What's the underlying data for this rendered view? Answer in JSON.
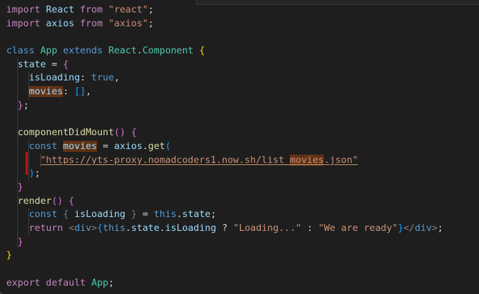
{
  "editor": {
    "lines": [
      [
        {
          "t": "import",
          "c": "ctl"
        },
        {
          "t": " ",
          "c": "pun"
        },
        {
          "t": "React",
          "c": "var"
        },
        {
          "t": " ",
          "c": "pun"
        },
        {
          "t": "from",
          "c": "ctl"
        },
        {
          "t": " ",
          "c": "pun"
        },
        {
          "t": "\"react\"",
          "c": "str"
        },
        {
          "t": ";",
          "c": "pun"
        }
      ],
      [
        {
          "t": "import",
          "c": "ctl"
        },
        {
          "t": " ",
          "c": "pun"
        },
        {
          "t": "axios",
          "c": "var"
        },
        {
          "t": " ",
          "c": "pun"
        },
        {
          "t": "from",
          "c": "ctl"
        },
        {
          "t": " ",
          "c": "pun"
        },
        {
          "t": "\"axios\"",
          "c": "str"
        },
        {
          "t": ";",
          "c": "pun"
        }
      ],
      [],
      [
        {
          "t": "class",
          "c": "kw"
        },
        {
          "t": " ",
          "c": "pun"
        },
        {
          "t": "App",
          "c": "cls"
        },
        {
          "t": " ",
          "c": "pun"
        },
        {
          "t": "extends",
          "c": "kw"
        },
        {
          "t": " ",
          "c": "pun"
        },
        {
          "t": "React",
          "c": "cls"
        },
        {
          "t": ".",
          "c": "pun"
        },
        {
          "t": "Component",
          "c": "cls"
        },
        {
          "t": " ",
          "c": "pun"
        },
        {
          "t": "{",
          "c": "br1"
        }
      ],
      [
        {
          "t": "  ",
          "c": "pun"
        },
        {
          "t": "state",
          "c": "var"
        },
        {
          "t": " = ",
          "c": "pun"
        },
        {
          "t": "{",
          "c": "br2"
        }
      ],
      [
        {
          "t": "    ",
          "c": "pun"
        },
        {
          "t": "isLoading",
          "c": "var"
        },
        {
          "t": ": ",
          "c": "pun"
        },
        {
          "t": "true",
          "c": "kw"
        },
        {
          "t": ",",
          "c": "pun"
        }
      ],
      [
        {
          "t": "    ",
          "c": "pun"
        },
        {
          "t": "movies",
          "c": "var hl"
        },
        {
          "t": ": ",
          "c": "pun"
        },
        {
          "t": "[]",
          "c": "br3"
        },
        {
          "t": ",",
          "c": "pun"
        }
      ],
      [
        {
          "t": "  ",
          "c": "pun"
        },
        {
          "t": "}",
          "c": "br2"
        },
        {
          "t": ";",
          "c": "pun"
        }
      ],
      [],
      [
        {
          "t": "  ",
          "c": "pun"
        },
        {
          "t": "componentDidMount",
          "c": "fn"
        },
        {
          "t": "() ",
          "c": "br2"
        },
        {
          "t": "{",
          "c": "br2"
        }
      ],
      [
        {
          "t": "    ",
          "c": "pun"
        },
        {
          "t": "const",
          "c": "kw"
        },
        {
          "t": " ",
          "c": "pun"
        },
        {
          "t": "movies",
          "c": "var hl"
        },
        {
          "t": " = ",
          "c": "pun"
        },
        {
          "t": "axios",
          "c": "var"
        },
        {
          "t": ".",
          "c": "pun"
        },
        {
          "t": "get",
          "c": "fn"
        },
        {
          "t": "(",
          "c": "br3"
        }
      ],
      [
        {
          "t": "      ",
          "c": "pun"
        },
        {
          "t": "\"https://yts-proxy.nomadcoders1.now.sh/list_",
          "c": "str bad"
        },
        {
          "t": "movies",
          "c": "str bad hl"
        },
        {
          "t": ".json\"",
          "c": "str bad"
        }
      ],
      [
        {
          "t": "    ",
          "c": "pun"
        },
        {
          "t": ")",
          "c": "br3"
        },
        {
          "t": ";",
          "c": "pun"
        }
      ],
      [
        {
          "t": "  ",
          "c": "pun"
        },
        {
          "t": "}",
          "c": "br2"
        }
      ],
      [
        {
          "t": "  ",
          "c": "pun"
        },
        {
          "t": "render",
          "c": "fn"
        },
        {
          "t": "() ",
          "c": "br2"
        },
        {
          "t": "{",
          "c": "br2"
        }
      ],
      [
        {
          "t": "    ",
          "c": "pun"
        },
        {
          "t": "const",
          "c": "kw"
        },
        {
          "t": " ",
          "c": "pun"
        },
        {
          "t": "{ ",
          "c": "dim"
        },
        {
          "t": "isLoading",
          "c": "var"
        },
        {
          "t": " }",
          "c": "dim"
        },
        {
          "t": " = ",
          "c": "pun"
        },
        {
          "t": "this",
          "c": "kw"
        },
        {
          "t": ".",
          "c": "pun"
        },
        {
          "t": "state",
          "c": "var"
        },
        {
          "t": ";",
          "c": "pun"
        }
      ],
      [
        {
          "t": "    ",
          "c": "pun"
        },
        {
          "t": "return",
          "c": "ctl"
        },
        {
          "t": " ",
          "c": "pun"
        },
        {
          "t": "<",
          "c": "tag"
        },
        {
          "t": "div",
          "c": "tagn"
        },
        {
          "t": ">",
          "c": "tag"
        },
        {
          "t": "{",
          "c": "br3"
        },
        {
          "t": "this",
          "c": "kw"
        },
        {
          "t": ".",
          "c": "pun"
        },
        {
          "t": "state",
          "c": "var"
        },
        {
          "t": ".",
          "c": "pun"
        },
        {
          "t": "isLoading",
          "c": "var"
        },
        {
          "t": " ? ",
          "c": "pun"
        },
        {
          "t": "\"Loading...\"",
          "c": "str"
        },
        {
          "t": " : ",
          "c": "pun"
        },
        {
          "t": "\"We are ready\"",
          "c": "str"
        },
        {
          "t": "}",
          "c": "br3"
        },
        {
          "t": "</",
          "c": "tag"
        },
        {
          "t": "div",
          "c": "tagn"
        },
        {
          "t": ">",
          "c": "tag"
        },
        {
          "t": ";",
          "c": "pun"
        }
      ],
      [
        {
          "t": "  ",
          "c": "pun"
        },
        {
          "t": "}",
          "c": "br2"
        }
      ],
      [
        {
          "t": "}",
          "c": "br1"
        }
      ],
      [],
      [
        {
          "t": "export",
          "c": "ctl"
        },
        {
          "t": " ",
          "c": "pun"
        },
        {
          "t": "default",
          "c": "ctl"
        },
        {
          "t": " ",
          "c": "pun"
        },
        {
          "t": "App",
          "c": "cls"
        },
        {
          "t": ";",
          "c": "pun"
        }
      ]
    ]
  },
  "colors": {
    "background": "#1e1e1e",
    "keyword": "#569cd6",
    "control": "#c586c0",
    "string": "#ce9178",
    "class": "#4ec9b0",
    "variable": "#9cdcfe",
    "function": "#dcdcaa",
    "selection_highlight": "#613214",
    "cursor_marker": "#c0151b"
  }
}
